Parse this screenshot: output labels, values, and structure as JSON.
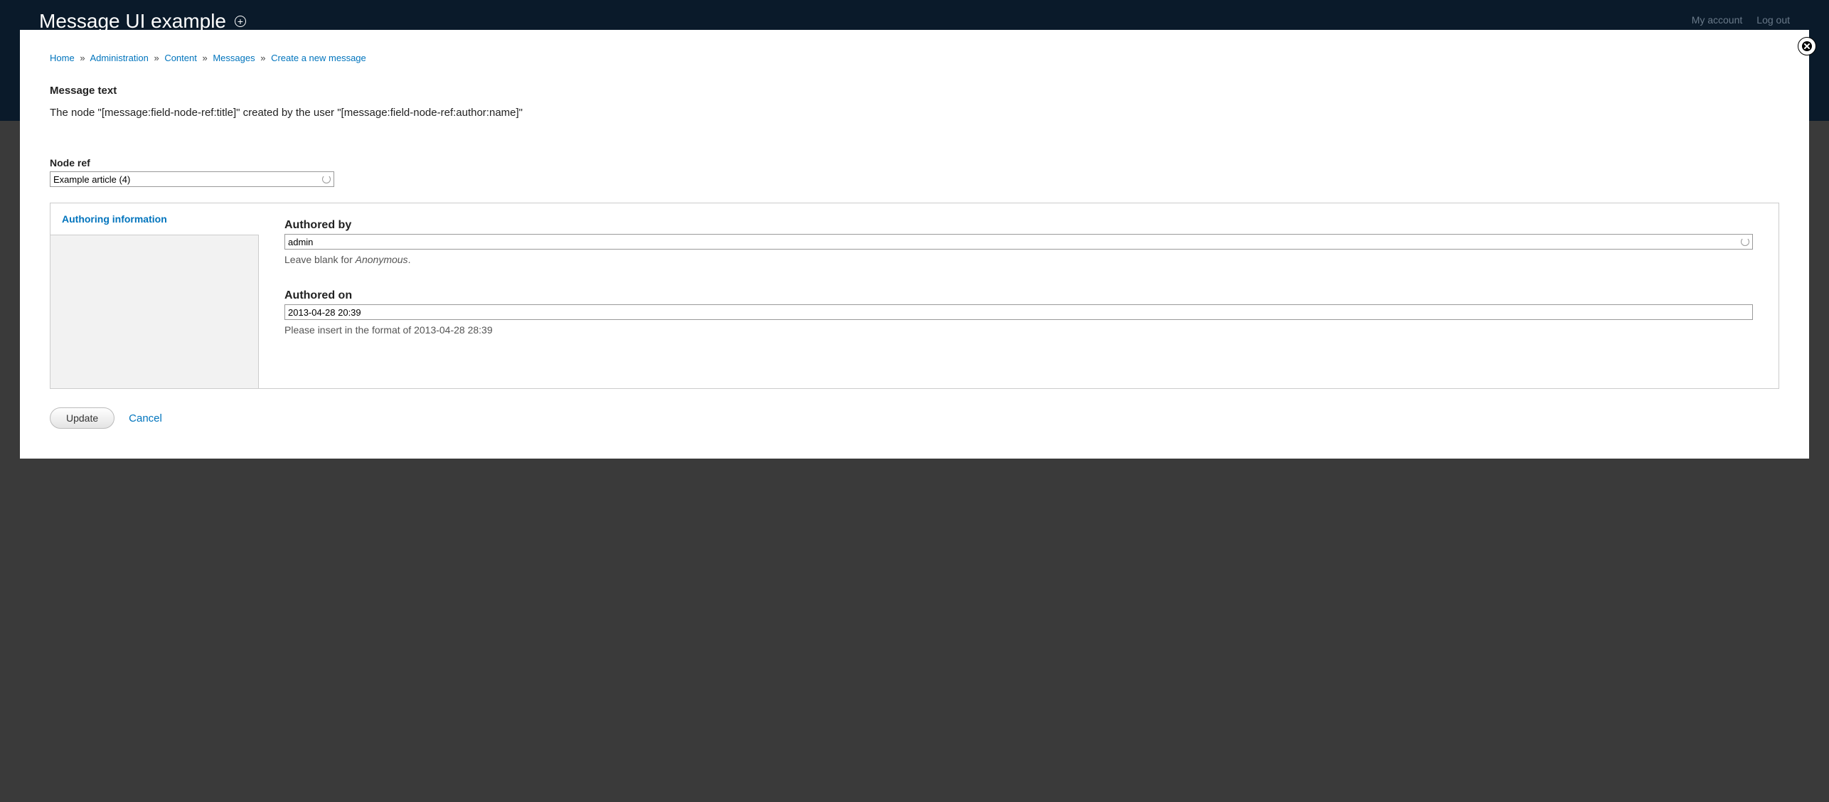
{
  "header": {
    "site_title": "Message UI example",
    "user_links": {
      "my_account": "My account",
      "log_out": "Log out"
    }
  },
  "breadcrumb": {
    "items": [
      "Home",
      "Administration",
      "Content",
      "Messages",
      "Create a new message"
    ],
    "separator": "»"
  },
  "message_text": {
    "label": "Message text",
    "body": "The node \"[message:field-node-ref:title]\" created by the user \"[message:field-node-ref:author:name]\""
  },
  "node_ref": {
    "label": "Node ref",
    "value": "Example article (4)"
  },
  "vertical_tabs": {
    "tab_label": "Authoring information"
  },
  "authored_by": {
    "label": "Authored by",
    "value": "admin",
    "help_prefix": "Leave blank for ",
    "help_em": "Anonymous",
    "help_suffix": "."
  },
  "authored_on": {
    "label": "Authored on",
    "value": "2013-04-28 20:39",
    "help": "Please insert in the format of 2013-04-28 28:39"
  },
  "actions": {
    "update": "Update",
    "cancel": "Cancel"
  }
}
